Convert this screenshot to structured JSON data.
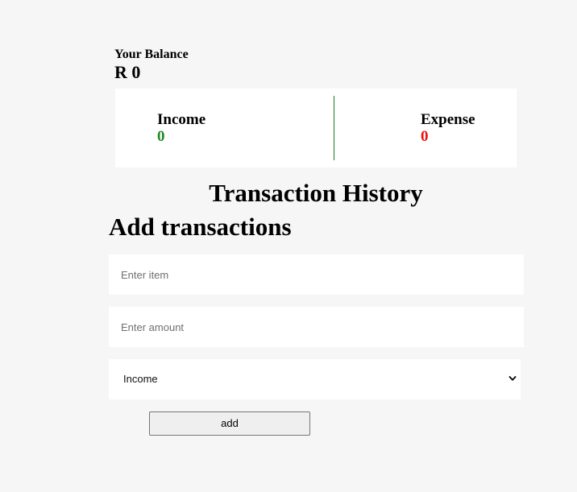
{
  "balance": {
    "label": "Your Balance",
    "value": "R 0"
  },
  "summary": {
    "income_label": "Income",
    "income_value": "0",
    "expense_label": "Expense",
    "expense_value": "0",
    "colors": {
      "income": "#1f8a1f",
      "expense": "#ee1111",
      "divider": "#1c7a1c"
    }
  },
  "history": {
    "title": "Transaction History"
  },
  "form": {
    "title": "Add transactions",
    "item_placeholder": "Enter item",
    "amount_placeholder": "Enter amount",
    "type_selected": "Income",
    "type_icon": "chevron-down-icon",
    "submit_label": "add"
  }
}
